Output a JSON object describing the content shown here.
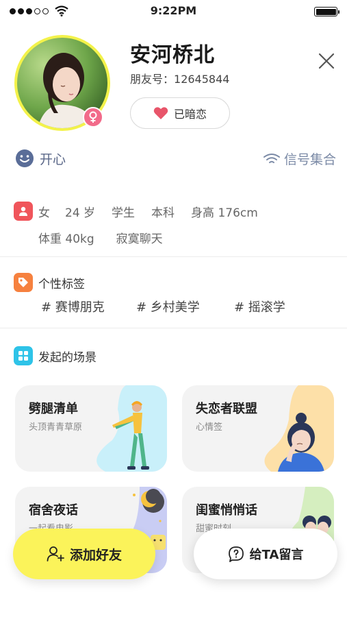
{
  "status_bar": {
    "time": "9:22PM"
  },
  "profile": {
    "name": "安河桥北",
    "friend_id_label": "朋友号：",
    "friend_id": "12645844",
    "crush_label": "已暗恋",
    "mood": "开心",
    "signal_set": "信号集合"
  },
  "basic_info": {
    "gender": "女",
    "age": "24 岁",
    "occupation": "学生",
    "education": "本科",
    "height": "身高 176cm",
    "weight": "体重 40kg",
    "status": "寂寞聊天"
  },
  "tags": {
    "title": "个性标签",
    "items": [
      "# 赛博朋克",
      "# 乡村美学",
      "# 摇滚学"
    ]
  },
  "scenes": {
    "title": "发起的场景",
    "cards": [
      {
        "title": "劈腿清单",
        "subtitle": "头顶青青草原"
      },
      {
        "title": "失恋者联盟",
        "subtitle": "心情签"
      },
      {
        "title": "宿舍夜话",
        "subtitle": "一起看电影"
      },
      {
        "title": "闺蜜悄悄话",
        "subtitle": "甜蜜时刻"
      }
    ]
  },
  "actions": {
    "add_friend": "添加好友",
    "leave_message": "给TA留言"
  },
  "colors": {
    "accent_yellow": "#fbf35a",
    "avatar_ring": "#f3f24a",
    "gender_pink": "#f26b8a",
    "heart": "#e8556a"
  }
}
